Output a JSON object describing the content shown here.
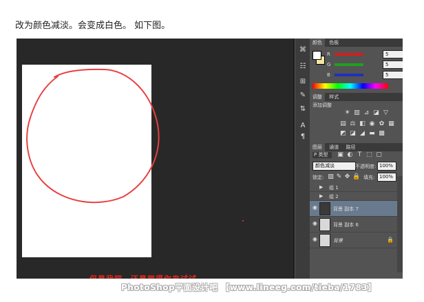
{
  "caption": "改为颜色减淡。会变成白色。 如下图。",
  "canvas_text": "但是我吧，还是觉得你来试试",
  "watermark": "PhotoShop平面设计吧 【www.lineeg.com/tieba/1783】",
  "color_panel": {
    "tabs": [
      "颜色",
      "色板"
    ],
    "sliders": [
      {
        "label": "R",
        "value": "5",
        "color": "#d02020"
      },
      {
        "label": "G",
        "value": "5",
        "color": "#20a020"
      },
      {
        "label": "B",
        "value": "5",
        "color": "#2030c0"
      }
    ]
  },
  "adjust_panel": {
    "tabs": [
      "调整",
      "样式"
    ],
    "title": "添加调整"
  },
  "layers_panel": {
    "tabs": [
      "图层",
      "通道",
      "路径"
    ],
    "kind": "P 类型",
    "blend_mode": "颜色减淡",
    "opacity_label": "不透明度:",
    "opacity_value": "100%",
    "lock_label": "锁定:",
    "fill_label": "填充:",
    "fill_value": "100%",
    "groups": [
      {
        "name": "组 1"
      },
      {
        "name": "组 2"
      }
    ],
    "layers": [
      {
        "name": "背景 副本 7",
        "selected": true
      },
      {
        "name": "背景 副本 6",
        "selected": false
      },
      {
        "name": "背景",
        "selected": false
      }
    ]
  }
}
